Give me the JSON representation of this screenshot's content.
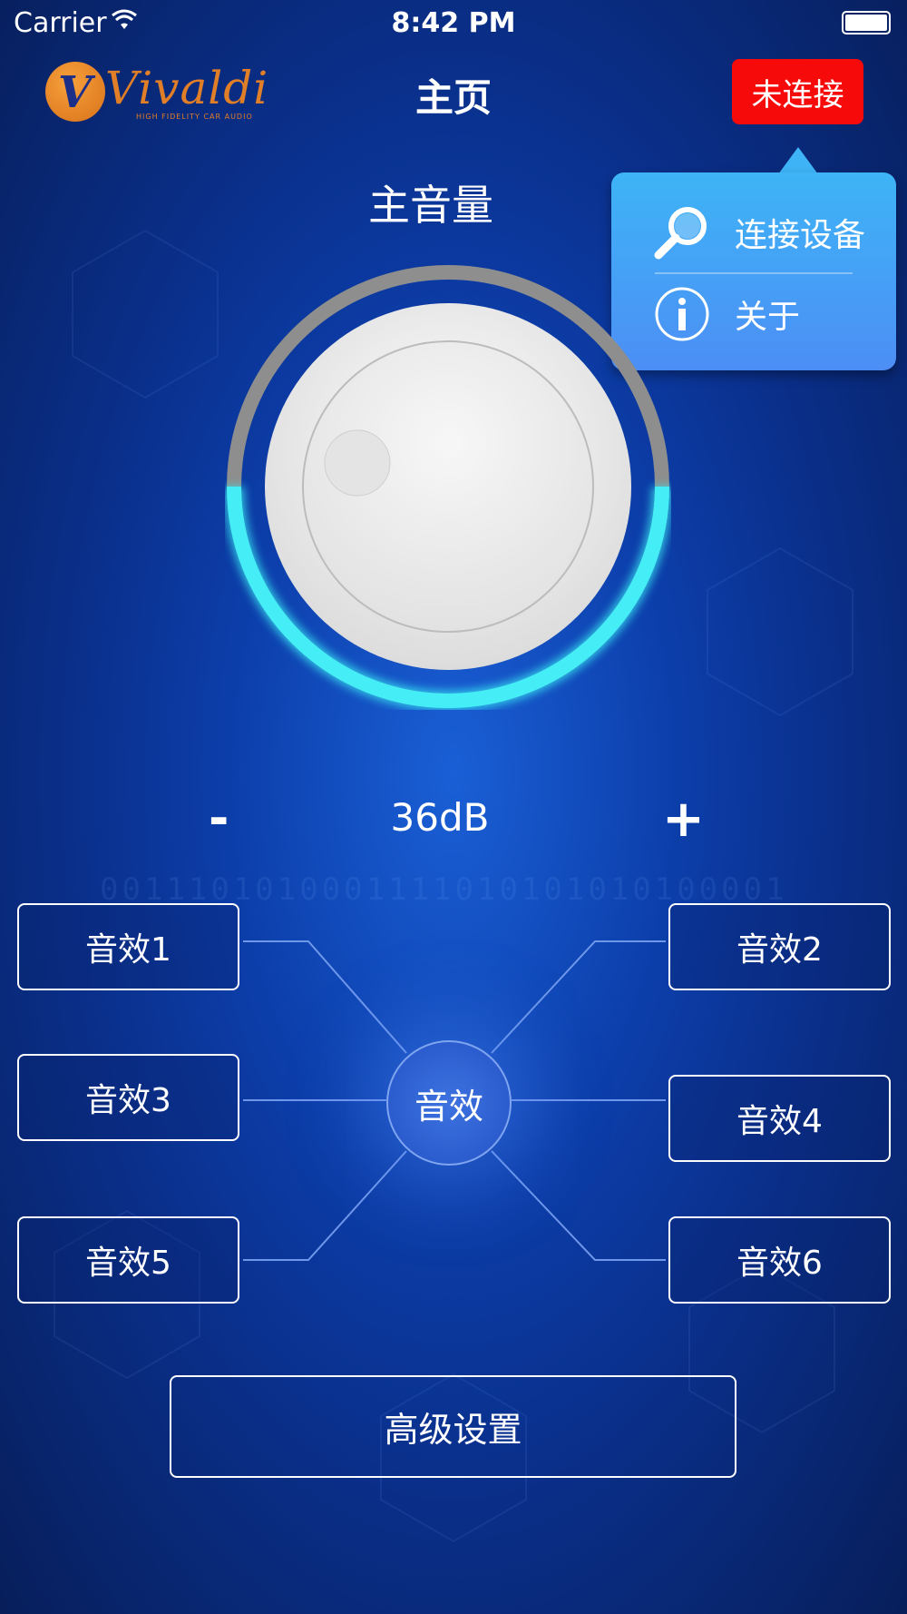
{
  "status_bar": {
    "carrier": "Carrier",
    "time": "8:42 PM"
  },
  "nav": {
    "logo_text": "Vivaldi",
    "logo_subtitle": "HIGH FIDELITY CAR AUDIO",
    "title": "主页",
    "connection_button": "未连接",
    "connection_color": "#f70a0a"
  },
  "popup_menu": {
    "items": [
      {
        "label": "连接设备",
        "icon": "search-icon"
      },
      {
        "label": "关于",
        "icon": "info-icon"
      }
    ]
  },
  "volume": {
    "title": "主音量",
    "value": "36dB",
    "minus_label": "-",
    "plus_label": "+",
    "level_fraction": 0.5
  },
  "effects": {
    "center_label": "音效",
    "items": [
      "音效1",
      "音效2",
      "音效3",
      "音效4",
      "音效5",
      "音效6"
    ]
  },
  "advanced_button": "高级设置",
  "background_digits": "0011101010001111010101010100001"
}
